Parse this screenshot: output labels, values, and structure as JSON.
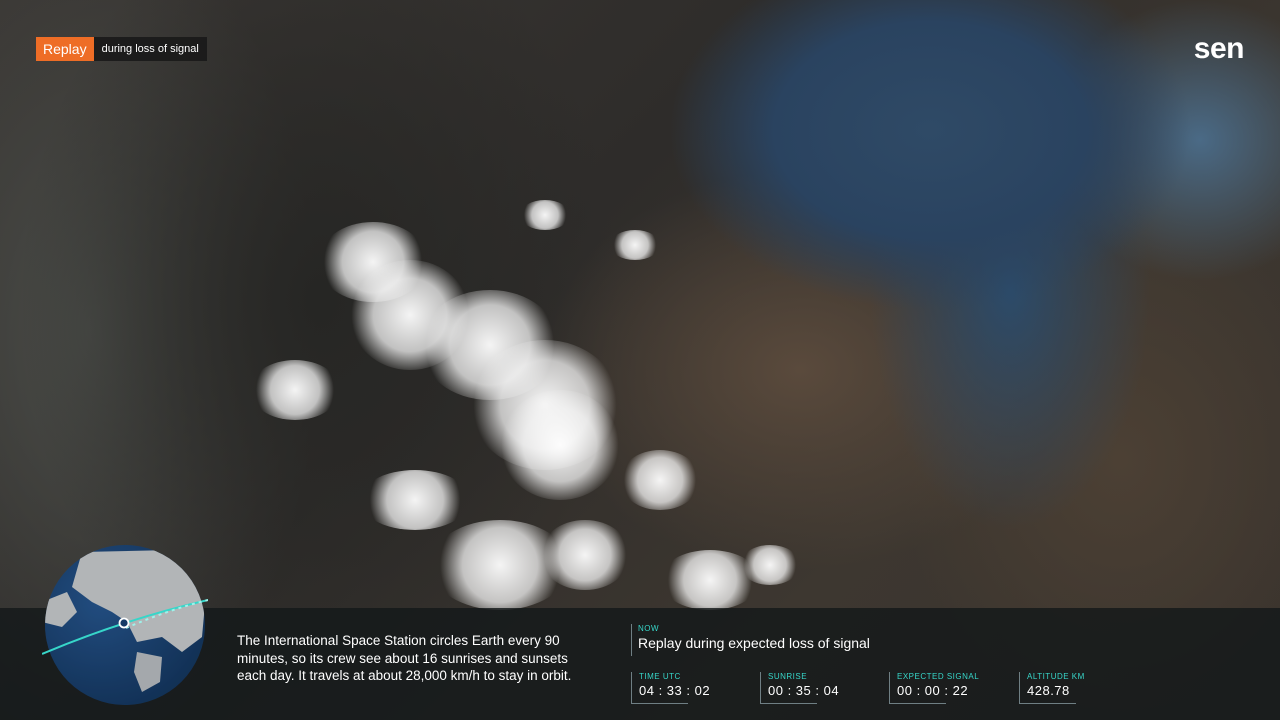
{
  "overlay": {
    "replay_badge": "Replay",
    "replay_note": "during loss of signal",
    "logo": "sen"
  },
  "info_panel": {
    "caption": "The International Space Station circles Earth every 90 minutes, so its crew see about 16 sunrises and sunsets each day. It travels at about 28,000 km/h to stay in orbit.",
    "now_label": "NOW",
    "now_text": "Replay during expected loss of signal",
    "metrics": [
      {
        "label": "TIME UTC",
        "value": "04 : 33 : 02"
      },
      {
        "label": "SUNRISE",
        "value": "00 : 35 : 04"
      },
      {
        "label": "EXPECTED SIGNAL",
        "value": "00 : 00 : 22"
      },
      {
        "label": "ALTITUDE km",
        "value": "428.78"
      }
    ]
  },
  "colors": {
    "accent_orange": "#ee6d26",
    "accent_teal": "#37d6c9",
    "globe_ocean": "#1e4f8a",
    "globe_land": "#d9dde0"
  },
  "icons": {
    "globe": "earth-globe-icon",
    "orbit": "orbit-path-icon",
    "station": "iss-marker-icon"
  }
}
